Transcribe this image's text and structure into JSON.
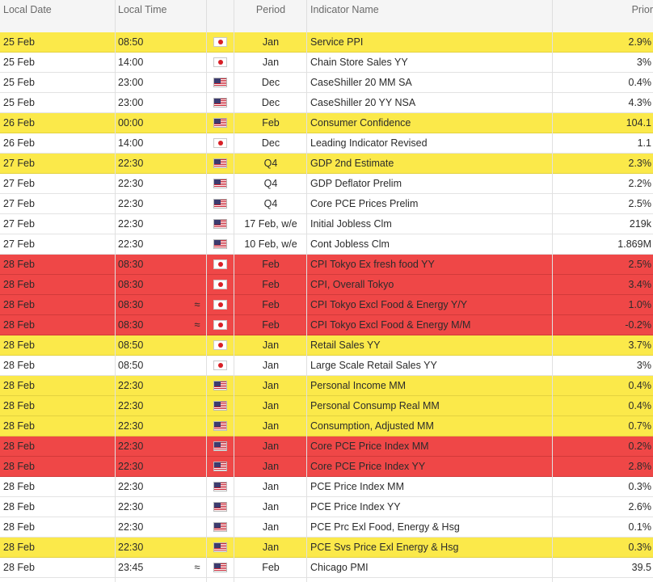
{
  "headers": {
    "date": "Local Date",
    "time": "Local Time",
    "period": "Period",
    "name": "Indicator Name",
    "prior": "Prior"
  },
  "icons": {
    "jp": "japan-flag-icon",
    "us": "us-flag-icon",
    "approx": "approximately-icon"
  },
  "approx_symbol": "≈",
  "colors": {
    "highlight_yellow": "#fbe94a",
    "highlight_red": "#ef4747"
  },
  "rows": [
    {
      "date": "25 Feb",
      "time": "08:50",
      "approx": false,
      "flag": "jp",
      "period": "Jan",
      "name": "Service PPI",
      "prior": "2.9%",
      "hl": "yellow"
    },
    {
      "date": "25 Feb",
      "time": "14:00",
      "approx": false,
      "flag": "jp",
      "period": "Jan",
      "name": "Chain Store Sales YY",
      "prior": "3%",
      "hl": "normal"
    },
    {
      "date": "25 Feb",
      "time": "23:00",
      "approx": false,
      "flag": "us",
      "period": "Dec",
      "name": "CaseShiller 20 MM SA",
      "prior": "0.4%",
      "hl": "normal"
    },
    {
      "date": "25 Feb",
      "time": "23:00",
      "approx": false,
      "flag": "us",
      "period": "Dec",
      "name": "CaseShiller 20 YY NSA",
      "prior": "4.3%",
      "hl": "normal"
    },
    {
      "date": "26 Feb",
      "time": "00:00",
      "approx": false,
      "flag": "us",
      "period": "Feb",
      "name": "Consumer Confidence",
      "prior": "104.1",
      "hl": "yellow"
    },
    {
      "date": "26 Feb",
      "time": "14:00",
      "approx": false,
      "flag": "jp",
      "period": "Dec",
      "name": "Leading Indicator Revised",
      "prior": "1.1",
      "hl": "normal"
    },
    {
      "date": "27 Feb",
      "time": "22:30",
      "approx": false,
      "flag": "us",
      "period": "Q4",
      "name": "GDP 2nd Estimate",
      "prior": "2.3%",
      "hl": "yellow"
    },
    {
      "date": "27 Feb",
      "time": "22:30",
      "approx": false,
      "flag": "us",
      "period": "Q4",
      "name": "GDP Deflator Prelim",
      "prior": "2.2%",
      "hl": "normal"
    },
    {
      "date": "27 Feb",
      "time": "22:30",
      "approx": false,
      "flag": "us",
      "period": "Q4",
      "name": "Core PCE Prices Prelim",
      "prior": "2.5%",
      "hl": "normal"
    },
    {
      "date": "27 Feb",
      "time": "22:30",
      "approx": false,
      "flag": "us",
      "period": "17 Feb, w/e",
      "name": "Initial Jobless Clm",
      "prior": "219k",
      "hl": "normal"
    },
    {
      "date": "27 Feb",
      "time": "22:30",
      "approx": false,
      "flag": "us",
      "period": "10 Feb, w/e",
      "name": "Cont Jobless Clm",
      "prior": "1.869M",
      "hl": "normal"
    },
    {
      "date": "28 Feb",
      "time": "08:30",
      "approx": false,
      "flag": "jp",
      "period": "Feb",
      "name": "CPI Tokyo Ex fresh food YY",
      "prior": "2.5%",
      "hl": "red"
    },
    {
      "date": "28 Feb",
      "time": "08:30",
      "approx": false,
      "flag": "jp",
      "period": "Feb",
      "name": "CPI, Overall Tokyo",
      "prior": "3.4%",
      "hl": "red"
    },
    {
      "date": "28 Feb",
      "time": "08:30",
      "approx": true,
      "flag": "jp",
      "period": "Feb",
      "name": "CPI Tokyo Excl Food & Energy Y/Y",
      "prior": "1.0%",
      "hl": "red"
    },
    {
      "date": "28 Feb",
      "time": "08:30",
      "approx": true,
      "flag": "jp",
      "period": "Feb",
      "name": "CPI Tokyo Excl Food & Energy M/M",
      "prior": "-0.2%",
      "hl": "red"
    },
    {
      "date": "28 Feb",
      "time": "08:50",
      "approx": false,
      "flag": "jp",
      "period": "Jan",
      "name": "Retail Sales YY",
      "prior": "3.7%",
      "hl": "yellow"
    },
    {
      "date": "28 Feb",
      "time": "08:50",
      "approx": false,
      "flag": "jp",
      "period": "Jan",
      "name": "Large Scale Retail Sales YY",
      "prior": "3%",
      "hl": "normal"
    },
    {
      "date": "28 Feb",
      "time": "22:30",
      "approx": false,
      "flag": "us",
      "period": "Jan",
      "name": "Personal Income MM",
      "prior": "0.4%",
      "hl": "yellow"
    },
    {
      "date": "28 Feb",
      "time": "22:30",
      "approx": false,
      "flag": "us",
      "period": "Jan",
      "name": "Personal Consump Real MM",
      "prior": "0.4%",
      "hl": "yellow"
    },
    {
      "date": "28 Feb",
      "time": "22:30",
      "approx": false,
      "flag": "us",
      "period": "Jan",
      "name": "Consumption, Adjusted MM",
      "prior": "0.7%",
      "hl": "yellow"
    },
    {
      "date": "28 Feb",
      "time": "22:30",
      "approx": false,
      "flag": "us",
      "period": "Jan",
      "name": "Core PCE Price Index MM",
      "prior": "0.2%",
      "hl": "red"
    },
    {
      "date": "28 Feb",
      "time": "22:30",
      "approx": false,
      "flag": "us",
      "period": "Jan",
      "name": "Core PCE Price Index YY",
      "prior": "2.8%",
      "hl": "red"
    },
    {
      "date": "28 Feb",
      "time": "22:30",
      "approx": false,
      "flag": "us",
      "period": "Jan",
      "name": "PCE Price Index MM",
      "prior": "0.3%",
      "hl": "normal"
    },
    {
      "date": "28 Feb",
      "time": "22:30",
      "approx": false,
      "flag": "us",
      "period": "Jan",
      "name": "PCE Price Index YY",
      "prior": "2.6%",
      "hl": "normal"
    },
    {
      "date": "28 Feb",
      "time": "22:30",
      "approx": false,
      "flag": "us",
      "period": "Jan",
      "name": "PCE Prc Exl Food, Energy & Hsg",
      "prior": "0.1%",
      "hl": "normal"
    },
    {
      "date": "28 Feb",
      "time": "22:30",
      "approx": false,
      "flag": "us",
      "period": "Jan",
      "name": "PCE Svs Price Exl Energy & Hsg",
      "prior": "0.3%",
      "hl": "yellow"
    },
    {
      "date": "28 Feb",
      "time": "23:45",
      "approx": true,
      "flag": "us",
      "period": "Feb",
      "name": "Chicago PMI",
      "prior": "39.5",
      "hl": "normal"
    }
  ]
}
